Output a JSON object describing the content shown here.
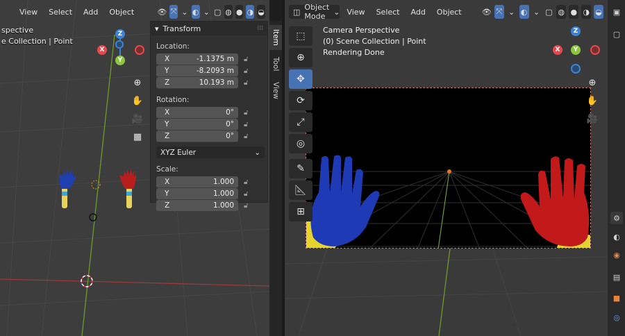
{
  "left_view": {
    "menu": [
      "View",
      "Select",
      "Add",
      "Object"
    ],
    "info_line1": "spective",
    "info_line2": "e Collection | Point"
  },
  "transform_panel": {
    "title": "Transform",
    "location_label": "Location:",
    "location": [
      {
        "axis": "X",
        "value": "-1.1375 m"
      },
      {
        "axis": "Y",
        "value": "-8.2093 m"
      },
      {
        "axis": "Z",
        "value": "10.193 m"
      }
    ],
    "rotation_label": "Rotation:",
    "rotation": [
      {
        "axis": "X",
        "value": "0°"
      },
      {
        "axis": "Y",
        "value": "0°"
      },
      {
        "axis": "Z",
        "value": "0°"
      }
    ],
    "rotation_mode": "XYZ Euler",
    "scale_label": "Scale:",
    "scale": [
      {
        "axis": "X",
        "value": "1.000"
      },
      {
        "axis": "Y",
        "value": "1.000"
      },
      {
        "axis": "Z",
        "value": "1.000"
      }
    ]
  },
  "side_tabs": [
    "Item",
    "Tool",
    "View"
  ],
  "right_view": {
    "mode": "Object Mode",
    "menu": [
      "View",
      "Select",
      "Add",
      "Object"
    ],
    "info_line1": "Camera Perspective",
    "info_line2": "(0) Scene Collection | Point",
    "info_line3": "Rendering Done"
  },
  "gizmo": {
    "x": "X",
    "y": "Y",
    "z": "Z"
  },
  "colors": {
    "x_axis": "#e5484d",
    "y_axis": "#8cc63f",
    "z_axis": "#3c82d6",
    "accent": "#4772b3"
  }
}
